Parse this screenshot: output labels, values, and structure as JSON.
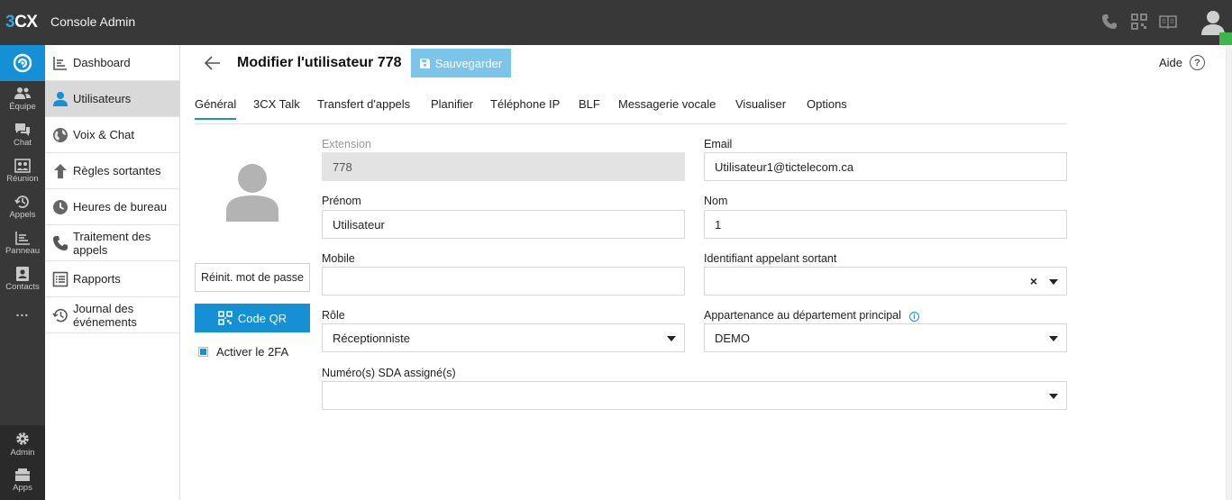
{
  "app": {
    "logo_num": "3",
    "logo_cx": "CX",
    "title": "Console Admin"
  },
  "rail": {
    "items": [
      {
        "label": "Équipe"
      },
      {
        "label": "Chat"
      },
      {
        "label": "Réunion"
      },
      {
        "label": "Appels"
      },
      {
        "label": "Panneau"
      },
      {
        "label": "Contacts"
      },
      {
        "label": "..."
      },
      {
        "label": "Admin"
      },
      {
        "label": "Apps"
      }
    ]
  },
  "subnav": {
    "items": [
      {
        "label": "Dashboard",
        "icon": "dashboard-icon"
      },
      {
        "label": "Utilisateurs",
        "icon": "user-icon",
        "active": true
      },
      {
        "label": "Voix & Chat",
        "icon": "globe-icon"
      },
      {
        "label": "Règles sortantes",
        "icon": "arrow-up-icon"
      },
      {
        "label": "Heures de bureau",
        "icon": "clock-icon"
      },
      {
        "label": "Traitement des appels",
        "icon": "phone-icon"
      },
      {
        "label": "Rapports",
        "icon": "report-icon"
      },
      {
        "label": "Journal des événements",
        "icon": "history-icon"
      }
    ]
  },
  "header": {
    "title": "Modifier l'utilisateur 778",
    "save_label": "Sauvegarder",
    "help_label": "Aide",
    "help_glyph": "?"
  },
  "tabs": [
    {
      "label": "Général",
      "active": true
    },
    {
      "label": "3CX Talk"
    },
    {
      "label": "Transfert d'appels"
    },
    {
      "label": "Planifier"
    },
    {
      "label": "Téléphone IP"
    },
    {
      "label": "BLF"
    },
    {
      "label": "Messagerie vocale"
    },
    {
      "label": "Visualiser"
    },
    {
      "label": "Options"
    }
  ],
  "profile": {
    "reset_label": "Réinit. mot de passe",
    "qr_label": "Code QR",
    "twofa_label": "Activer le 2FA",
    "twofa_checked": true
  },
  "form": {
    "extension": {
      "label": "Extension",
      "value": "778"
    },
    "email": {
      "label": "Email",
      "value": "Utilisateur1@tictelecom.ca"
    },
    "prenom": {
      "label": "Prénom",
      "value": "Utilisateur"
    },
    "nom": {
      "label": "Nom",
      "value": "1"
    },
    "mobile": {
      "label": "Mobile",
      "value": ""
    },
    "caller_id": {
      "label": "Identifiant appelant sortant",
      "value": "",
      "clear_glyph": "×"
    },
    "role": {
      "label": "Rôle",
      "value": "Réceptionniste"
    },
    "department": {
      "label": "Appartenance au département principal",
      "value": "DEMO",
      "info_glyph": "i"
    },
    "did": {
      "label": "Numéro(s) SDA assigné(s)",
      "value": ""
    }
  },
  "colors": {
    "accent": "#1590d5",
    "topbar": "#383838",
    "save_button": "#7cc5ea",
    "status": "#3cb54a"
  }
}
